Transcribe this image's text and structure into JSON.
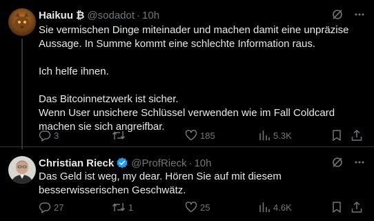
{
  "tweet1": {
    "display_name": "Haikuu ₿",
    "handle": "@sodadot",
    "separator": "·",
    "time": "10h",
    "text": "Sie vermischen Dinge miteinader und machen damit eine unpräzise Aussage. In Summe kommt eine schlechte Information raus.\n\nIch helfe ihnen.\n\nDas Bitcoinnetzwerk ist sicher.\nWenn User unsichere Schlüssel verwenden wie im Fall Coldcard machen sie sich angreifbar.",
    "replies": "3",
    "reposts": "",
    "likes": "185",
    "views": "5.3K"
  },
  "tweet2": {
    "display_name": "Christian Rieck",
    "handle": "@ProfRieck",
    "separator": "·",
    "time": "10h",
    "text": "Das Geld ist weg, my dear. Hören Sie auf mit diesem besserwisserischen Geschwätz.",
    "replies": "27",
    "reposts": "1",
    "likes": "25",
    "views": "4.6K"
  },
  "colors": {
    "background": "#000000",
    "text": "#e7e9ea",
    "muted": "#71767b",
    "verified": "#1d9bf0",
    "divider": "#2f3336"
  }
}
